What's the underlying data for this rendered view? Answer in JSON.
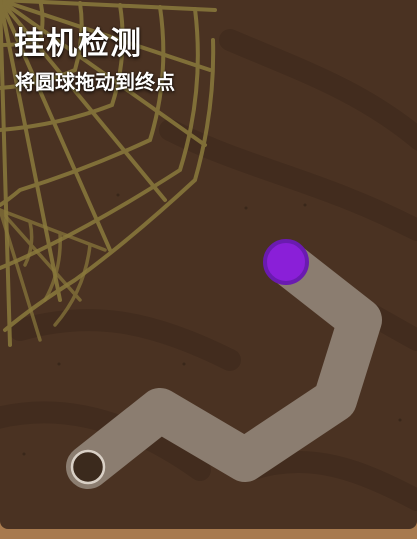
{
  "captcha": {
    "title": "挂机检测",
    "instruction": "将圆球拖动到终点"
  },
  "colors": {
    "background": "#4a3222",
    "frame": "#a87a4e",
    "web": "#8a7a3c",
    "track": "#8b7d70",
    "ball": "#8a1fd8",
    "ball_ring": "#6a1bb0"
  },
  "icons": {
    "decoration": "spider-web-icon",
    "draggable": "ball-handle",
    "target": "finish-ring"
  }
}
